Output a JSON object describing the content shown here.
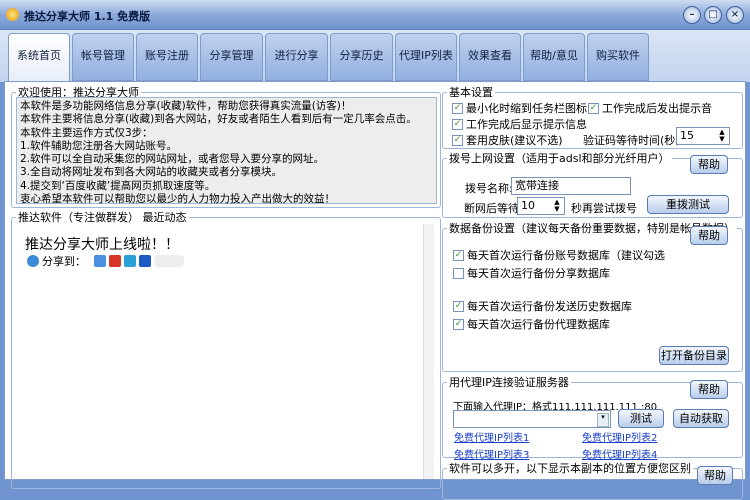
{
  "window": {
    "title": "推达分享大师 1.1 免费版",
    "min": "–",
    "max": "□",
    "close": "×"
  },
  "tabs": [
    "系统首页",
    "帐号管理",
    "账号注册",
    "分享管理",
    "进行分享",
    "分享历史",
    "代理IP列表",
    "效果查看",
    "帮助/意见",
    "购买软件"
  ],
  "welcome": {
    "legend": "欢迎使用：推达分享大师",
    "lines": [
      "本软件是多功能网络信息分享(收藏)软件，帮助您获得真实流量(访客)！",
      "本软件主要将信息分享(收藏)到各大网站，好友或者陌生人看到后有一定几率会点击。",
      "本软件主要运作方式仅3步：",
      "1.软件辅助您注册各大网站账号。",
      "2.软件可以全自动采集您的网站网址，或者您导入要分享的网址。",
      "3.全自动将网址发布到各大网站的收藏夹或者分享模块。",
      "4.提交到‘百度收藏’提高网页抓取速度等。",
      "衷心希望本软件可以帮助您以最少的人力物力投入产出做大的效益！"
    ]
  },
  "news": {
    "legend": "推达软件（专注做群发） 最近动态",
    "headline": "推达分享大师上线啦！！",
    "share_label": "分享到："
  },
  "basic": {
    "legend": "基本设置",
    "opt1": "最小化时缩到任务栏图标",
    "opt2": "工作完成后发出提示音",
    "opt3": "工作完成后显示提示信息",
    "opt4": "套用皮肤(建议不选)",
    "captcha_label": "验证码等待时间(秒)",
    "captcha_value": "15"
  },
  "dial": {
    "legend": "拨号上网设置（适用于adsl和部分光纤用户）",
    "help": "帮助",
    "name_label": "拨号名称:",
    "name_value": "宽带连接",
    "wait_label": "断网后等待",
    "wait_value": "10",
    "wait_suffix": "秒再尝试拨号",
    "redial": "重拨测试"
  },
  "backup": {
    "legend": "数据备份设置（建议每天备份重要数据，特别是帐号数据）",
    "help": "帮助",
    "opt1": "每天首次运行备份账号数据库（建议勾选",
    "opt2": "每天首次运行备份分享数据库",
    "opt3": "每天首次运行备份发送历史数据库",
    "opt4": "每天首次运行备份代理数据库",
    "open": "打开备份目录"
  },
  "proxy": {
    "legend": "用代理IP连接验证服务器",
    "help": "帮助",
    "hint": "下面输入代理IP：格式111.111.111.111.:80",
    "value": "",
    "test": "测试",
    "auto": "自动获取",
    "links": [
      "免费代理IP列表1",
      "免费代理IP列表2",
      "免费代理IP列表3",
      "免费代理IP列表4"
    ]
  },
  "multi": {
    "legend": "软件可以多开，以下显示本副本的位置方便您区别",
    "help": "帮助"
  }
}
